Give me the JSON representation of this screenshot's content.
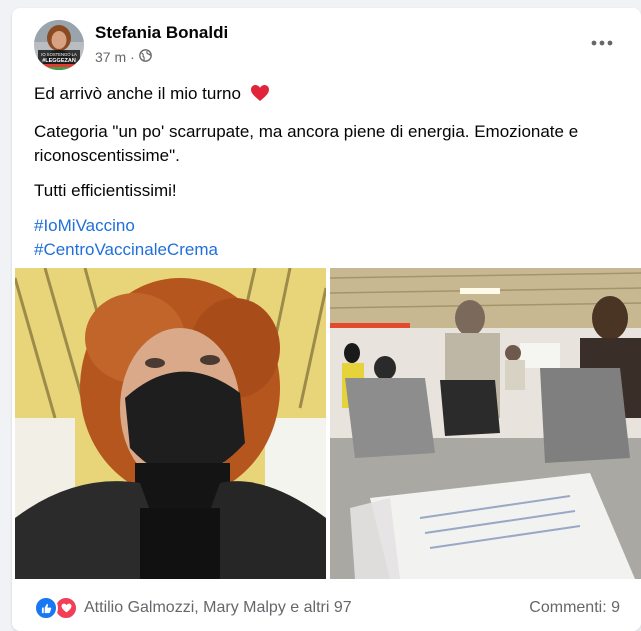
{
  "post": {
    "author": "Stefania Bonaldi",
    "time": "37 m",
    "separator": "·",
    "privacy_icon": "globe-icon",
    "more_icon": "more-dots-icon",
    "avatar_badge_text": [
      "IO SOSTENGO LA",
      "#LEGGEZAN"
    ],
    "text": {
      "line1": "Ed arrivò anche il mio turno",
      "line1_emoji": "red-heart-icon",
      "line2": "Categoria \"un po' scarrupate, ma ancora piene di energia. Emozionate e riconoscentissime\".",
      "line3": "Tutti efficientissimi!"
    },
    "hashtags": [
      "#IoMiVaccino",
      "#CentroVaccinaleCrema"
    ],
    "photos": [
      {
        "name": "selfie-photo",
        "description_icon": "photo"
      },
      {
        "name": "waiting-room-photo",
        "description_icon": "photo"
      }
    ],
    "footer": {
      "reactions_text": "Attilio Galmozzi, Mary Malpy e altri 97",
      "comments_text": "Commenti: 9",
      "reaction_icons": [
        "like-icon",
        "love-icon"
      ]
    }
  },
  "colors": {
    "hashtag": "#216fdb",
    "like": "#1877f2",
    "love": "#f33e58",
    "muted": "#65676b"
  }
}
